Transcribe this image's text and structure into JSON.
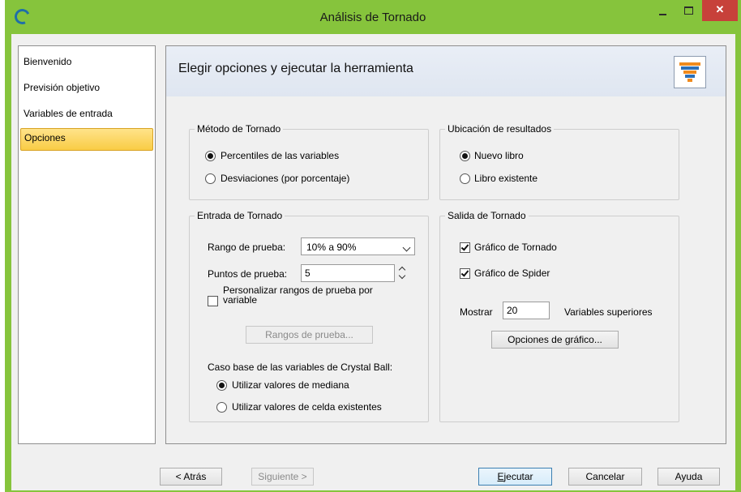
{
  "window": {
    "title": "Análisis de Tornado",
    "close_glyph": "✕"
  },
  "sidebar": {
    "items": [
      {
        "label": "Bienvenido",
        "active": false
      },
      {
        "label": "Previsión objetivo",
        "active": false
      },
      {
        "label": "Variables de entrada",
        "active": false
      },
      {
        "label": "Opciones",
        "active": true
      }
    ]
  },
  "panel": {
    "title": "Elegir opciones y ejecutar la herramienta",
    "method_group": {
      "legend": "Método de Tornado",
      "options": [
        "Percentiles de las variables",
        "Desviaciones (por porcentaje)"
      ],
      "selected": 0
    },
    "location_group": {
      "legend": "Ubicación de resultados",
      "options": [
        "Nuevo libro",
        "Libro existente"
      ],
      "selected": 0
    },
    "input_group": {
      "legend": "Entrada de Tornado",
      "range_label": "Rango de prueba:",
      "range_value": "10% a 90%",
      "points_label": "Puntos de prueba:",
      "points_value": "5",
      "custom_check_label_1": "Personalizar rangos de prueba por",
      "custom_check_label_2": "variable",
      "custom_checked": false,
      "ranges_button": "Rangos de prueba...",
      "base_case_label": "Caso base de las variables de Crystal Ball:",
      "base_options": [
        "Utilizar valores de mediana",
        "Utilizar valores de celda existentes"
      ],
      "base_selected": 0
    },
    "output_group": {
      "legend": "Salida de Tornado",
      "tornado_chart_label": "Gráfico de Tornado",
      "tornado_checked": true,
      "spider_chart_label": "Gráfico de Spider",
      "spider_checked": true,
      "show_label": "Mostrar",
      "show_value": "20",
      "top_vars_label": "Variables superiores",
      "chart_options_button": "Opciones de gráfico..."
    }
  },
  "footer": {
    "back": "< Atrás",
    "next": "Siguiente >",
    "run_prefix": "E",
    "run_rest": "jecutar",
    "cancel": "Cancelar",
    "help": "Ayuda"
  },
  "colors": {
    "accent": "#86c43c",
    "selected_item": "#fdd96b",
    "close": "#c7413a"
  }
}
